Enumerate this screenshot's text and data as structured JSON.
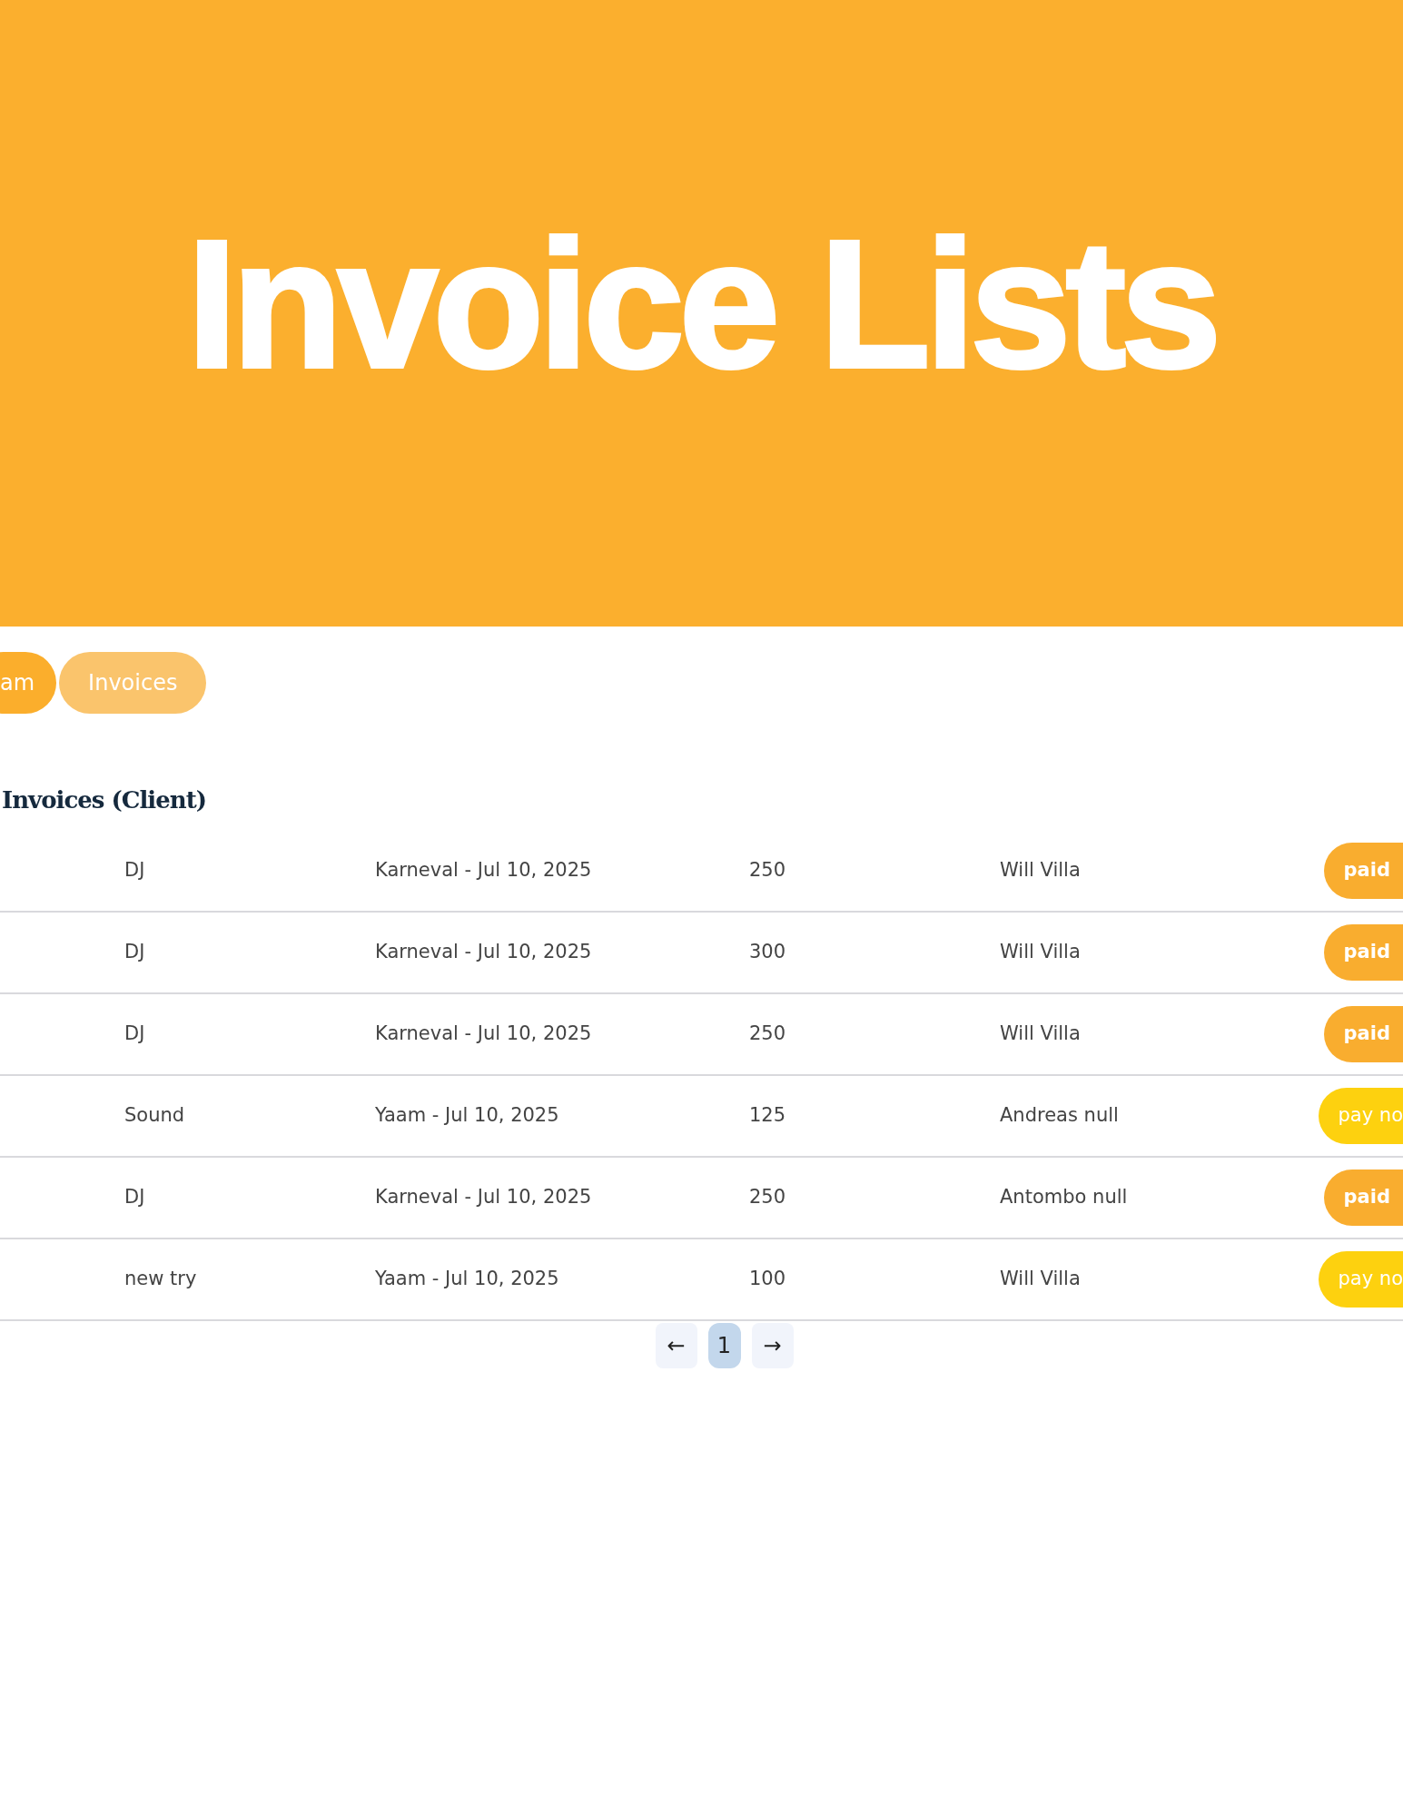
{
  "banner": {
    "title": "Invoice Lists"
  },
  "tabs": [
    {
      "label": "am",
      "selected": true
    },
    {
      "label": "Invoices",
      "selected": false
    }
  ],
  "section_title": "Invoices (Client)",
  "table": {
    "rows": [
      {
        "service": "DJ",
        "event": "Karneval - Jul 10, 2025",
        "amount": "250",
        "client": "Will Villa",
        "status": {
          "kind": "paid",
          "label": "paid"
        }
      },
      {
        "service": "DJ",
        "event": "Karneval - Jul 10, 2025",
        "amount": "300",
        "client": "Will Villa",
        "status": {
          "kind": "paid",
          "label": "paid"
        }
      },
      {
        "service": "DJ",
        "event": "Karneval - Jul 10, 2025",
        "amount": "250",
        "client": "Will Villa",
        "status": {
          "kind": "paid",
          "label": "paid"
        }
      },
      {
        "service": "Sound",
        "event": "Yaam - Jul 10, 2025",
        "amount": "125",
        "client": "Andreas null",
        "status": {
          "kind": "unpaid",
          "label": "pay no"
        }
      },
      {
        "service": "DJ",
        "event": "Karneval - Jul 10, 2025",
        "amount": "250",
        "client": "Antombo null",
        "status": {
          "kind": "paid",
          "label": "paid"
        }
      },
      {
        "service": "new try",
        "event": "Yaam - Jul 10, 2025",
        "amount": "100",
        "client": "Will Villa",
        "status": {
          "kind": "unpaid",
          "label": "pay no"
        }
      }
    ]
  },
  "pagination": {
    "prev": "←",
    "pages": [
      {
        "label": "1",
        "selected": true
      }
    ],
    "next": "→"
  }
}
